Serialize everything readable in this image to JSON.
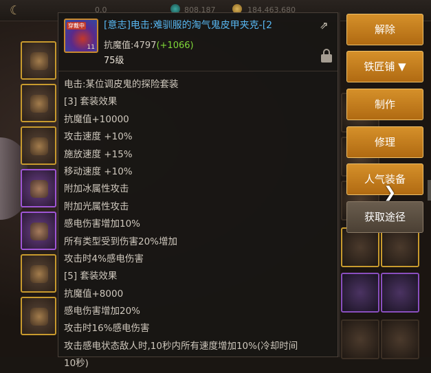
{
  "topbar": {
    "back_icon": "back-arrow-icon",
    "stat_1": "0.0",
    "stat_2": "808,187",
    "stat_3": "184,463,680"
  },
  "tooltip": {
    "item": {
      "icon_tag": "穿戴中",
      "icon_level": "11",
      "title": "[意志]电击:难驯服的淘气鬼皮甲夹克-[2",
      "resist_label": "抗魔值:4797",
      "resist_bonus": "(+1066)",
      "level": "75级"
    },
    "lines": [
      "电击:某位调皮鬼的探险套装",
      "[3] 套装效果",
      "抗魔值+10000",
      "攻击速度 +10%",
      "施放速度 +15%",
      "移动速度 +10%",
      "附加冰属性攻击",
      "附加光属性攻击",
      "感电伤害增加10%",
      "所有类型受到伤害20%增加",
      "攻击时4%感电伤害",
      "[5] 套装效果",
      "抗魔值+8000",
      "感电伤害增加20%",
      "攻击时16%感电伤害",
      "攻击感电状态敌人时,10秒内所有速度增加10%(冷却时间",
      "10秒)"
    ]
  },
  "buttons": {
    "unequip": "解除",
    "blacksmith": "铁匠铺 ▼",
    "craft": "制作",
    "repair": "修理",
    "popular": "人气装备",
    "obtain": "获取途径"
  },
  "colors": {
    "title": "#57b6f0",
    "bonus": "#7fd838",
    "button": "#c47e1e",
    "button_dim": "#5a4e40"
  }
}
